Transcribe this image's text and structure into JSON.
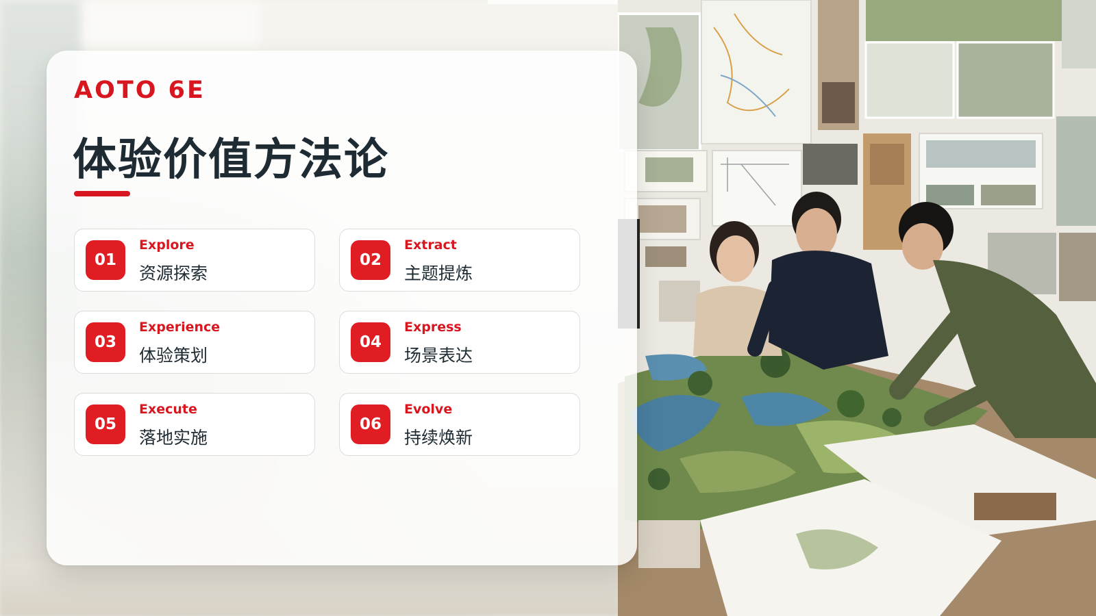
{
  "brand": "AOTO 6E",
  "title": "体验价值方法论",
  "accent_color": "#d7161f",
  "steps": [
    {
      "number": "01",
      "en": "Explore",
      "cn": "资源探索"
    },
    {
      "number": "02",
      "en": "Extract",
      "cn": "主题提炼"
    },
    {
      "number": "03",
      "en": "Experience",
      "cn": "体验策划"
    },
    {
      "number": "04",
      "en": "Express",
      "cn": "场景表达"
    },
    {
      "number": "05",
      "en": "Execute",
      "cn": "落地实施"
    },
    {
      "number": "06",
      "en": "Evolve",
      "cn": "持续焕新"
    }
  ]
}
